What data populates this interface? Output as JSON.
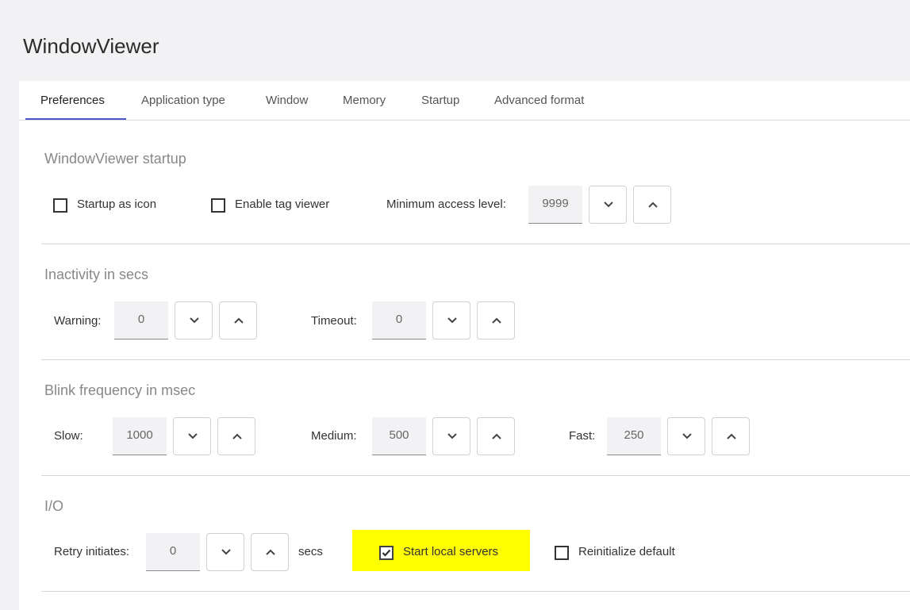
{
  "app": {
    "title": "WindowViewer"
  },
  "tabs": [
    {
      "label": "Preferences"
    },
    {
      "label": "Application type"
    },
    {
      "label": "Window"
    },
    {
      "label": "Memory"
    },
    {
      "label": "Startup"
    },
    {
      "label": "Advanced format"
    }
  ],
  "startup_section": {
    "title": "WindowViewer startup",
    "startup_as_icon": {
      "label": "Startup as icon",
      "checked": false
    },
    "enable_tag_viewer": {
      "label": "Enable tag viewer",
      "checked": false
    },
    "min_access": {
      "label": "Minimum access level:",
      "value": "9999"
    }
  },
  "inactivity_section": {
    "title": "Inactivity in secs",
    "warning": {
      "label": "Warning:",
      "value": "0"
    },
    "timeout": {
      "label": "Timeout:",
      "value": "0"
    }
  },
  "blink_section": {
    "title": "Blink frequency in msec",
    "slow": {
      "label": "Slow:",
      "value": "1000"
    },
    "medium": {
      "label": "Medium:",
      "value": "500"
    },
    "fast": {
      "label": "Fast:",
      "value": "250"
    }
  },
  "io_section": {
    "title": "I/O",
    "retry": {
      "label": "Retry initiates:",
      "value": "0",
      "unit": "secs"
    },
    "start_local_servers": {
      "label": "Start local servers",
      "checked": true
    },
    "reinitialize_default": {
      "label": "Reinitialize default",
      "checked": false
    }
  },
  "colors": {
    "accent": "#4c55c9",
    "highlight": "#ffff00",
    "field_bg": "#f2f2f4"
  },
  "icons": {
    "decrement": "chevron-down-icon",
    "increment": "chevron-up-icon",
    "check": "checkmark-icon"
  }
}
